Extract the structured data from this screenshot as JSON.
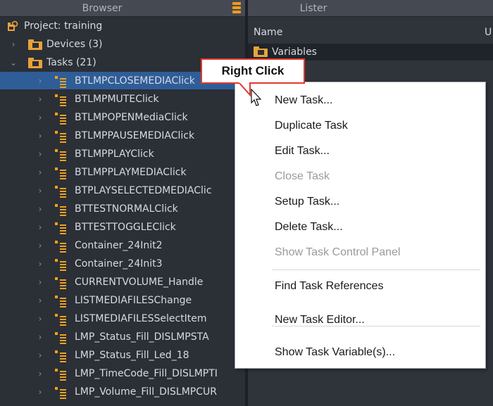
{
  "browser": {
    "title": "Browser",
    "project_label": "Project: training",
    "devices_label": "Devices (3)",
    "tasks_label": "Tasks (21)",
    "tasks": [
      "BTLMPCLOSEMEDIAClick",
      "BTLMPMUTEClick",
      "BTLMPOPENMediaClick",
      "BTLMPPAUSEMEDIAClick",
      "BTLMPPLAYClick",
      "BTLMPPLAYMEDIAClick",
      "BTPLAYSELECTEDMEDIAClic",
      "BTTESTNORMALClick",
      "BTTESTTOGGLEClick",
      "Container_24Init2",
      "Container_24Init3",
      "CURRENTVOLUME_Handle",
      "LISTMEDIAFILESChange",
      "LISTMEDIAFILESSelectItem",
      "LMP_Status_Fill_DISLMPSTA",
      "LMP_Status_Fill_Led_18",
      "LMP_TimeCode_Fill_DISLMPTI",
      "LMP_Volume_Fill_DISLMPCUR"
    ],
    "selected_index": 0
  },
  "lister": {
    "title": "Lister",
    "col_name": "Name",
    "col_u": "U",
    "variables_label": "Variables"
  },
  "callout": {
    "text": "Right Click"
  },
  "context_menu": {
    "items": [
      {
        "label": "New Task...",
        "enabled": true
      },
      {
        "label": "Duplicate Task",
        "enabled": true
      },
      {
        "label": "Edit Task...",
        "enabled": true
      },
      {
        "label": "Close Task",
        "enabled": false
      },
      {
        "label": "Setup Task...",
        "enabled": true
      },
      {
        "label": "Delete Task...",
        "enabled": true
      },
      {
        "label": "Show Task Control Panel",
        "enabled": false
      },
      {
        "label": "Find Task References",
        "enabled": true
      },
      {
        "label": "New Task Editor...",
        "enabled": true
      },
      {
        "label": "Show Task Variable(s)...",
        "enabled": true
      }
    ]
  },
  "colors": {
    "accent": "#f29b1d",
    "selection": "#2f5d98",
    "callout_border": "#e03a2f"
  }
}
